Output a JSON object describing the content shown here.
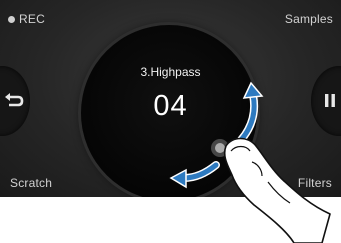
{
  "status": {
    "rec_label": "REC"
  },
  "labels": {
    "top_right": "Samples",
    "bottom_left": "Scratch",
    "bottom_right": "Filters"
  },
  "dial": {
    "title": "3.Highpass",
    "value": "04"
  },
  "icons": {
    "left_button": "back-arrow-icon",
    "right_button": "pause-icon",
    "gesture": "rotate-gesture-arrows",
    "hand": "pointing-finger"
  }
}
